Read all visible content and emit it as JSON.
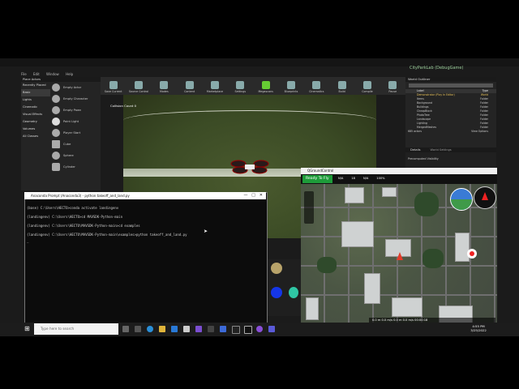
{
  "unreal": {
    "window_title": "CityParkLab (DebugGame)",
    "menu": [
      "File",
      "Edit",
      "Window",
      "Help"
    ],
    "modes_panel_title": "Place Actors",
    "categories": [
      "Recently Placed",
      "Basic",
      "Lights",
      "Cinematic",
      "Visual Effects",
      "Geometry",
      "Volumes",
      "All Classes"
    ],
    "place_items": [
      "Empty Actor",
      "Empty Character",
      "Empty Pawn",
      "Point Light",
      "Player Start",
      "Cube",
      "Sphere",
      "Cylinder"
    ],
    "toolbar": [
      "Save Current",
      "Source Control",
      "Modes",
      "Content",
      "Marketplace",
      "Settings",
      "Megascans",
      "Blueprints",
      "Cinematics",
      "Build",
      "Compile",
      "Pause",
      "Stop",
      "Eject"
    ],
    "viewport_label": "Collision Count 0",
    "outliner_title": "World Outliner",
    "outliner_cols": [
      "Label",
      "Type"
    ],
    "outliner_rows": [
      {
        "label": "Demonstrator (Play In Editor)",
        "type": "World"
      },
      {
        "label": "Items",
        "type": "Folder"
      },
      {
        "label": "Background",
        "type": "Folder"
      },
      {
        "label": "Buildings",
        "type": "Folder"
      },
      {
        "label": "CheapBlock",
        "type": "Folder"
      },
      {
        "label": "PhotoTree",
        "type": "Folder"
      },
      {
        "label": "Landscape",
        "type": "Folder"
      },
      {
        "label": "Lighting",
        "type": "Folder"
      },
      {
        "label": "MergedMeshes",
        "type": "Folder"
      }
    ],
    "outliner_count": "685 actors",
    "view_options": "View Options",
    "details_tab": "Details",
    "world_settings_tab": "World Settings",
    "precomputed": "Precomputed Visibility"
  },
  "terminal": {
    "title": "Anaconda Prompt (Anaconda3) - python takeoff_and_land.py",
    "lines": [
      "(base) C:\\Users\\HECTO>conda activate landingenv",
      "(landingenv) C:\\Users\\HECTO>cd MAVSDK-Python-main",
      "(landingenv) C:\\Users\\HECTO\\MAVSDK-Python-main>cd examples",
      "(landingenv) C:\\Users\\HECTO\\MAVSDK-Python-main\\examples>python takeoff_and_land.py",
      "_"
    ]
  },
  "dji": {
    "window_title": "QGroundControl",
    "ready": "Ready To Fly",
    "status_items": [
      "N/A",
      "18",
      "N/A",
      "100%"
    ],
    "telemetry": "0.0 m   0.0 m/s   0.0 m   0.0 m/s   00:00:18"
  },
  "taskbar": {
    "search_placeholder": "Type here to search",
    "time": "4:55 PM",
    "date": "3/25/2022"
  },
  "colors": {
    "ready_green": "#1e9c3a",
    "record_red": "#e22222"
  }
}
